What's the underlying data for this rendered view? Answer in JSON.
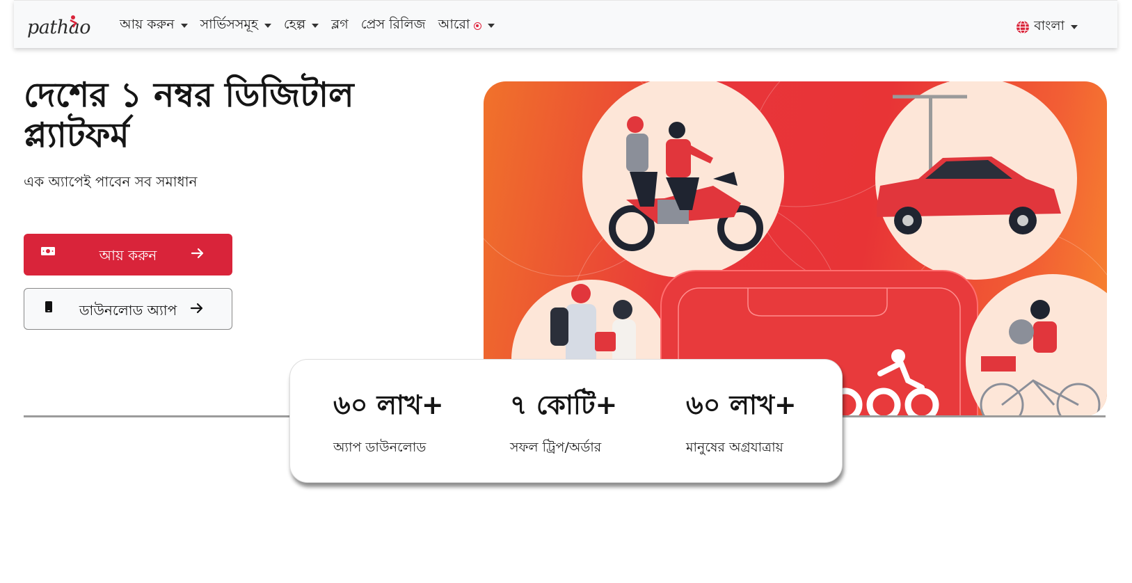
{
  "brand": {
    "logo_text": "pathao",
    "accent": "#d9243a"
  },
  "nav": {
    "items": [
      {
        "label": "আয় করুন",
        "dropdown": true
      },
      {
        "label": "সার্ভিসসমূহ",
        "dropdown": true
      },
      {
        "label": "হেল্প",
        "dropdown": true
      },
      {
        "label": "ব্লগ",
        "dropdown": false
      },
      {
        "label": "প্রেস রিলিজ",
        "dropdown": false
      },
      {
        "label": "আরো",
        "dropdown": true
      }
    ],
    "language": "বাংলা"
  },
  "hero": {
    "title": "দেশের ১ নম্বর ডিজিটাল প্ল্যাটফর্ম",
    "subtitle": "এক অ্যাপেই পাবেন সব সমাধান",
    "earn_button": "আয় করুন",
    "download_button": "ডাউনলোড অ্যাপ"
  },
  "stats": [
    {
      "value": "৬০ লাখ+",
      "label": "অ্যাপ ডাউনলোড"
    },
    {
      "value": "৭ কোটি+",
      "label": "সফল ট্রিপ/অর্ডার"
    },
    {
      "value": "৬০ লাখ+",
      "label": "মানুষের অগ্রযাত্রায়"
    }
  ]
}
